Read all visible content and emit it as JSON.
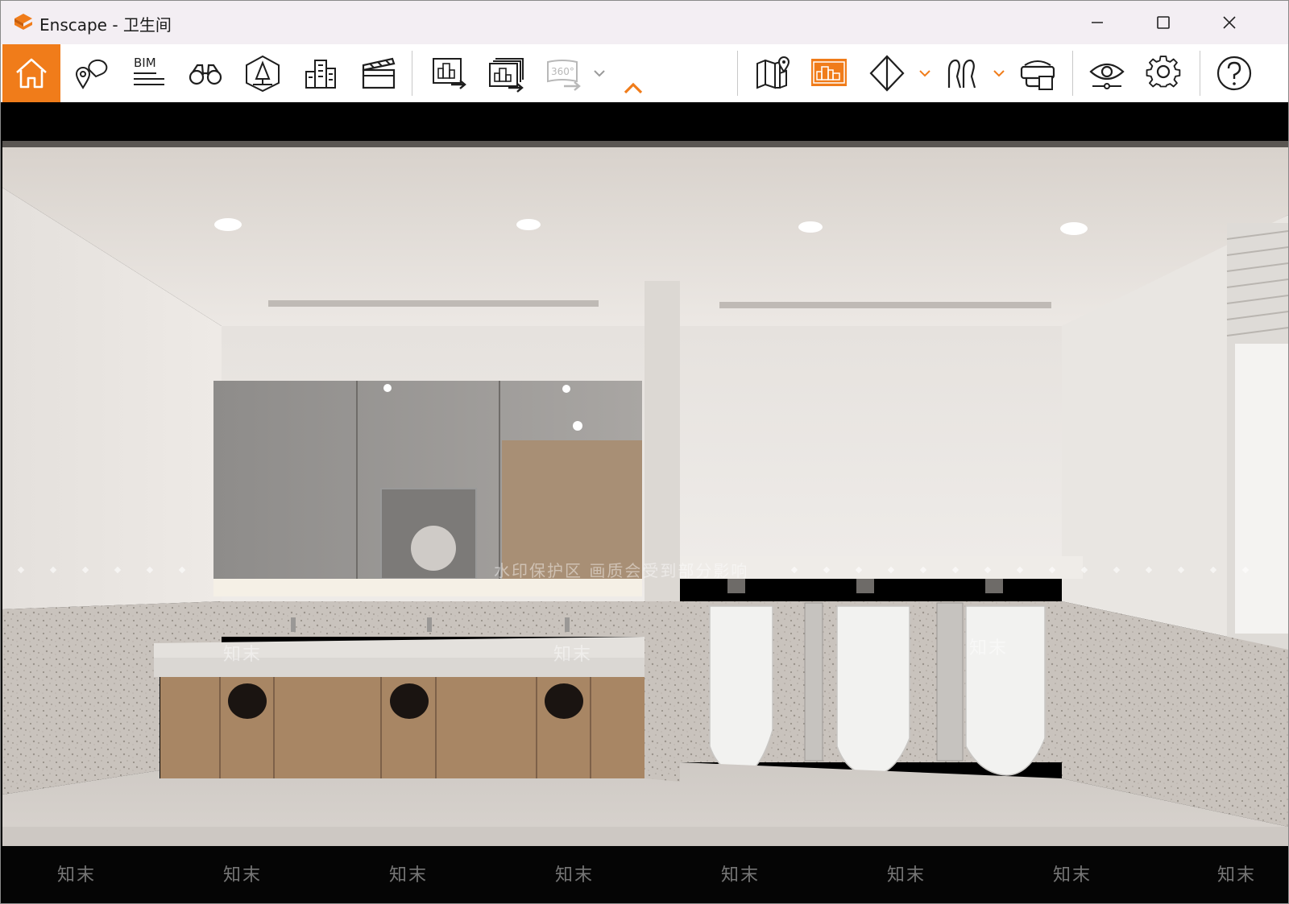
{
  "window": {
    "app_name": "Enscape",
    "separator": " - ",
    "document_name": "卫生间",
    "title": "Enscape - 卫生间"
  },
  "colors": {
    "accent": "#f07c1a",
    "titlebar_bg": "#f3eef3",
    "toolbar_bg": "#ffffff",
    "icon_stroke": "#1e1e1e",
    "icon_disabled": "#b8b8b8"
  },
  "titlebar_buttons": [
    {
      "name": "minimize-button",
      "icon": "minimize-icon"
    },
    {
      "name": "maximize-button",
      "icon": "maximize-icon"
    },
    {
      "name": "close-button",
      "icon": "close-icon"
    }
  ],
  "toolbar": {
    "items": [
      {
        "name": "home-button",
        "icon": "home-icon",
        "active": true
      },
      {
        "name": "views-button",
        "icon": "location-pins-icon"
      },
      {
        "name": "bim-button",
        "icon": "bim-icon",
        "label": "BIM"
      },
      {
        "name": "asset-library-button",
        "icon": "binoculars-icon"
      },
      {
        "name": "atmosphere-button",
        "icon": "tree-icon"
      },
      {
        "name": "asset-library-buildings-button",
        "icon": "buildings-icon"
      },
      {
        "name": "video-editor-button",
        "icon": "clapperboard-icon"
      },
      {
        "name": "render-image-button",
        "icon": "render-image-icon"
      },
      {
        "name": "batch-render-button",
        "icon": "batch-render-icon"
      },
      {
        "name": "panorama-button",
        "icon": "panorama-360-icon",
        "label": "360°",
        "disabled": true
      },
      {
        "name": "collapse-toolbar-button",
        "icon": "chevron-up-icon"
      },
      {
        "name": "map-button",
        "icon": "map-icon"
      },
      {
        "name": "minimap-button",
        "icon": "minimap-icon",
        "active_accent": true
      },
      {
        "name": "section-button",
        "icon": "section-diamond-icon"
      },
      {
        "name": "walk-mode-button",
        "icon": "walk-icon"
      },
      {
        "name": "vr-headset-button",
        "icon": "vr-headset-icon"
      },
      {
        "name": "visual-settings-eye-button",
        "icon": "eye-settings-icon"
      },
      {
        "name": "settings-button",
        "icon": "gear-icon"
      },
      {
        "name": "help-button",
        "icon": "help-icon"
      }
    ]
  },
  "watermark": {
    "banner": "水印保护区   画质会受到部分影响",
    "brand_mark": "知末"
  }
}
